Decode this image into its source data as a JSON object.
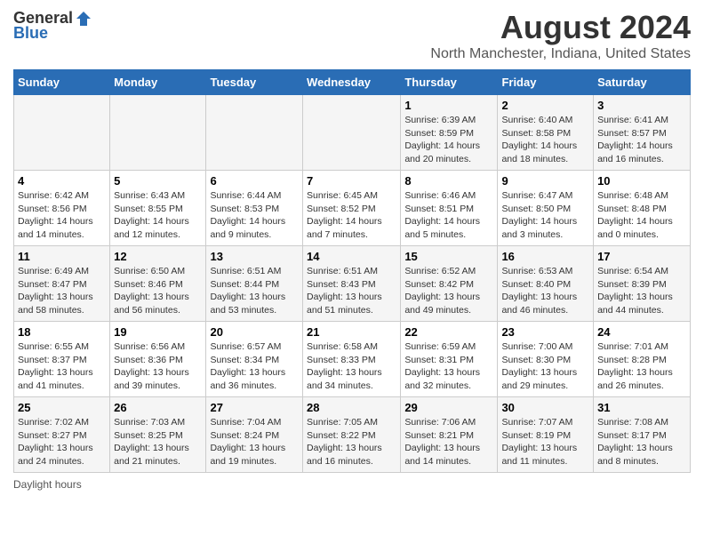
{
  "header": {
    "logo_general": "General",
    "logo_blue": "Blue",
    "title": "August 2024",
    "subtitle": "North Manchester, Indiana, United States"
  },
  "days_of_week": [
    "Sunday",
    "Monday",
    "Tuesday",
    "Wednesday",
    "Thursday",
    "Friday",
    "Saturday"
  ],
  "weeks": [
    [
      {
        "day": "",
        "content": ""
      },
      {
        "day": "",
        "content": ""
      },
      {
        "day": "",
        "content": ""
      },
      {
        "day": "",
        "content": ""
      },
      {
        "day": "1",
        "content": "Sunrise: 6:39 AM\nSunset: 8:59 PM\nDaylight: 14 hours and 20 minutes."
      },
      {
        "day": "2",
        "content": "Sunrise: 6:40 AM\nSunset: 8:58 PM\nDaylight: 14 hours and 18 minutes."
      },
      {
        "day": "3",
        "content": "Sunrise: 6:41 AM\nSunset: 8:57 PM\nDaylight: 14 hours and 16 minutes."
      }
    ],
    [
      {
        "day": "4",
        "content": "Sunrise: 6:42 AM\nSunset: 8:56 PM\nDaylight: 14 hours and 14 minutes."
      },
      {
        "day": "5",
        "content": "Sunrise: 6:43 AM\nSunset: 8:55 PM\nDaylight: 14 hours and 12 minutes."
      },
      {
        "day": "6",
        "content": "Sunrise: 6:44 AM\nSunset: 8:53 PM\nDaylight: 14 hours and 9 minutes."
      },
      {
        "day": "7",
        "content": "Sunrise: 6:45 AM\nSunset: 8:52 PM\nDaylight: 14 hours and 7 minutes."
      },
      {
        "day": "8",
        "content": "Sunrise: 6:46 AM\nSunset: 8:51 PM\nDaylight: 14 hours and 5 minutes."
      },
      {
        "day": "9",
        "content": "Sunrise: 6:47 AM\nSunset: 8:50 PM\nDaylight: 14 hours and 3 minutes."
      },
      {
        "day": "10",
        "content": "Sunrise: 6:48 AM\nSunset: 8:48 PM\nDaylight: 14 hours and 0 minutes."
      }
    ],
    [
      {
        "day": "11",
        "content": "Sunrise: 6:49 AM\nSunset: 8:47 PM\nDaylight: 13 hours and 58 minutes."
      },
      {
        "day": "12",
        "content": "Sunrise: 6:50 AM\nSunset: 8:46 PM\nDaylight: 13 hours and 56 minutes."
      },
      {
        "day": "13",
        "content": "Sunrise: 6:51 AM\nSunset: 8:44 PM\nDaylight: 13 hours and 53 minutes."
      },
      {
        "day": "14",
        "content": "Sunrise: 6:51 AM\nSunset: 8:43 PM\nDaylight: 13 hours and 51 minutes."
      },
      {
        "day": "15",
        "content": "Sunrise: 6:52 AM\nSunset: 8:42 PM\nDaylight: 13 hours and 49 minutes."
      },
      {
        "day": "16",
        "content": "Sunrise: 6:53 AM\nSunset: 8:40 PM\nDaylight: 13 hours and 46 minutes."
      },
      {
        "day": "17",
        "content": "Sunrise: 6:54 AM\nSunset: 8:39 PM\nDaylight: 13 hours and 44 minutes."
      }
    ],
    [
      {
        "day": "18",
        "content": "Sunrise: 6:55 AM\nSunset: 8:37 PM\nDaylight: 13 hours and 41 minutes."
      },
      {
        "day": "19",
        "content": "Sunrise: 6:56 AM\nSunset: 8:36 PM\nDaylight: 13 hours and 39 minutes."
      },
      {
        "day": "20",
        "content": "Sunrise: 6:57 AM\nSunset: 8:34 PM\nDaylight: 13 hours and 36 minutes."
      },
      {
        "day": "21",
        "content": "Sunrise: 6:58 AM\nSunset: 8:33 PM\nDaylight: 13 hours and 34 minutes."
      },
      {
        "day": "22",
        "content": "Sunrise: 6:59 AM\nSunset: 8:31 PM\nDaylight: 13 hours and 32 minutes."
      },
      {
        "day": "23",
        "content": "Sunrise: 7:00 AM\nSunset: 8:30 PM\nDaylight: 13 hours and 29 minutes."
      },
      {
        "day": "24",
        "content": "Sunrise: 7:01 AM\nSunset: 8:28 PM\nDaylight: 13 hours and 26 minutes."
      }
    ],
    [
      {
        "day": "25",
        "content": "Sunrise: 7:02 AM\nSunset: 8:27 PM\nDaylight: 13 hours and 24 minutes."
      },
      {
        "day": "26",
        "content": "Sunrise: 7:03 AM\nSunset: 8:25 PM\nDaylight: 13 hours and 21 minutes."
      },
      {
        "day": "27",
        "content": "Sunrise: 7:04 AM\nSunset: 8:24 PM\nDaylight: 13 hours and 19 minutes."
      },
      {
        "day": "28",
        "content": "Sunrise: 7:05 AM\nSunset: 8:22 PM\nDaylight: 13 hours and 16 minutes."
      },
      {
        "day": "29",
        "content": "Sunrise: 7:06 AM\nSunset: 8:21 PM\nDaylight: 13 hours and 14 minutes."
      },
      {
        "day": "30",
        "content": "Sunrise: 7:07 AM\nSunset: 8:19 PM\nDaylight: 13 hours and 11 minutes."
      },
      {
        "day": "31",
        "content": "Sunrise: 7:08 AM\nSunset: 8:17 PM\nDaylight: 13 hours and 8 minutes."
      }
    ]
  ],
  "footer": {
    "daylight_hours_label": "Daylight hours"
  },
  "colors": {
    "header_bg": "#2a6db5",
    "accent": "#2a6db5"
  }
}
